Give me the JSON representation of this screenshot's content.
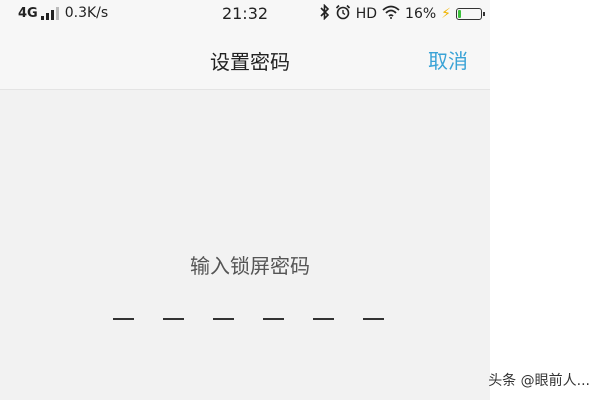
{
  "status_bar": {
    "network": "4G",
    "signal_bars_filled": 3,
    "speed": "0.3K/s",
    "time": "21:32",
    "icons": [
      "bluetooth-icon",
      "alarm-icon",
      "wifi-icon"
    ],
    "hd": "HD",
    "battery_percent_label": "16%",
    "battery_level": 0.16,
    "charging": true,
    "battery_color": "#3cc13c",
    "bolt_color": "#f0b400"
  },
  "navbar": {
    "title": "设置密码",
    "cancel_label": "取消",
    "accent_color": "#3aa3d6"
  },
  "main": {
    "prompt": "输入锁屏密码",
    "pin_length": 6,
    "pin_entered": 0
  },
  "watermark": "头条 @眼前人..."
}
